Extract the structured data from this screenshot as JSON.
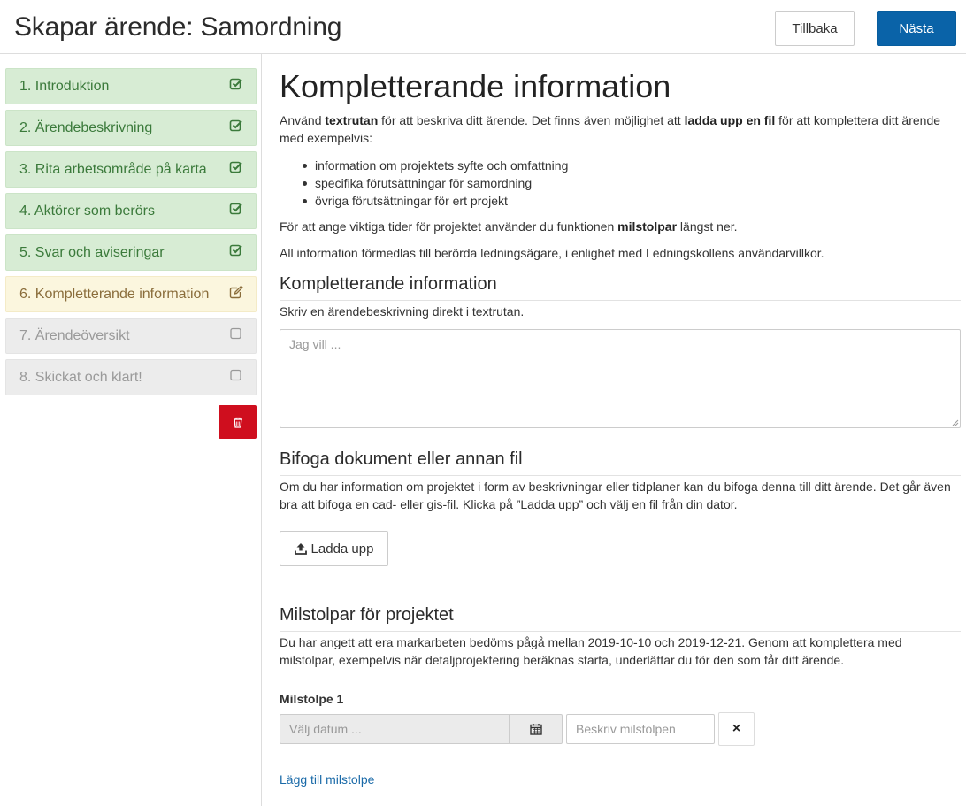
{
  "header": {
    "title": "Skapar ärende: Samordning",
    "back_label": "Tillbaka",
    "next_label": "Nästa"
  },
  "colors": {
    "primary": "#0a63a8",
    "done_bg": "#d7ecd4",
    "done_text": "#3b7a3b",
    "active_bg": "#fbf6de",
    "active_text": "#8a6d3b",
    "todo_bg": "#ececec",
    "danger": "#cf0e1e",
    "link": "#1a6aa8"
  },
  "sidebar": {
    "steps": [
      {
        "label": "1. Introduktion",
        "status": "done",
        "icon": "check-square-icon"
      },
      {
        "label": "2. Ärendebeskrivning",
        "status": "done",
        "icon": "check-square-icon"
      },
      {
        "label": "3. Rita arbetsområde på karta",
        "status": "done",
        "icon": "check-square-icon"
      },
      {
        "label": "4. Aktörer som berörs",
        "status": "done",
        "icon": "check-square-icon"
      },
      {
        "label": "5. Svar och aviseringar",
        "status": "done",
        "icon": "check-square-icon"
      },
      {
        "label": "6. Kompletterande information",
        "status": "active",
        "icon": "edit-icon"
      },
      {
        "label": "7. Ärendeöversikt",
        "status": "todo",
        "icon": "empty-checkbox-icon"
      },
      {
        "label": "8. Skickat och klart!",
        "status": "todo",
        "icon": "empty-checkbox-icon"
      }
    ],
    "delete_icon": "trash-icon"
  },
  "main": {
    "heading": "Kompletterande information",
    "intro": {
      "t1": "Använd ",
      "b1": "textrutan",
      "t2": " för att beskriva ditt ärende. Det finns även möjlighet att ",
      "b2": "ladda upp en fil",
      "t3": " för att komplettera ditt ärende med exempelvis:"
    },
    "bullets": [
      "information om projektets syfte och omfattning",
      "specifika förutsättningar för samordning",
      "övriga förutsättningar för ert projekt"
    ],
    "milestone_note": {
      "t1": "För att ange viktiga tider för projektet använder du funktionen ",
      "b1": "milstolpar",
      "t2": " längst ner."
    },
    "terms_text": "All information förmedlas till berörda ledningsägare, i enlighet med Ledningskollens användarvillkor.",
    "info_section": {
      "heading": "Kompletterande information",
      "help": "Skriv en ärendebeskrivning direkt i textrutan.",
      "textarea_placeholder": "Jag vill ...",
      "textarea_value": ""
    },
    "attach_section": {
      "heading": "Bifoga dokument eller annan fil",
      "text": "Om du har information om projektet i form av beskrivningar eller tidplaner kan du bifoga denna till ditt ärende. Det går även bra att bifoga en cad- eller gis-fil. Klicka på ”Ladda upp” och välj en fil från din dator.",
      "upload_label": "Ladda upp",
      "upload_icon": "upload-icon"
    },
    "milestones_section": {
      "heading": "Milstolpar för projektet",
      "text": "Du har angett att era markarbeten bedöms pågå mellan 2019-10-10 och 2019-12-21. Genom att komplettera med milstolpar, exempelvis när detaljprojektering beräknas starta, underlättar du för den som får ditt ärende.",
      "milestone_label": "Milstolpe 1",
      "date_placeholder": "Välj datum ...",
      "date_value": "",
      "calendar_icon": "calendar-icon",
      "description_placeholder": "Beskriv milstolpen",
      "description_value": "",
      "remove_label": "×",
      "add_link": "Lägg till milstolpe"
    }
  }
}
